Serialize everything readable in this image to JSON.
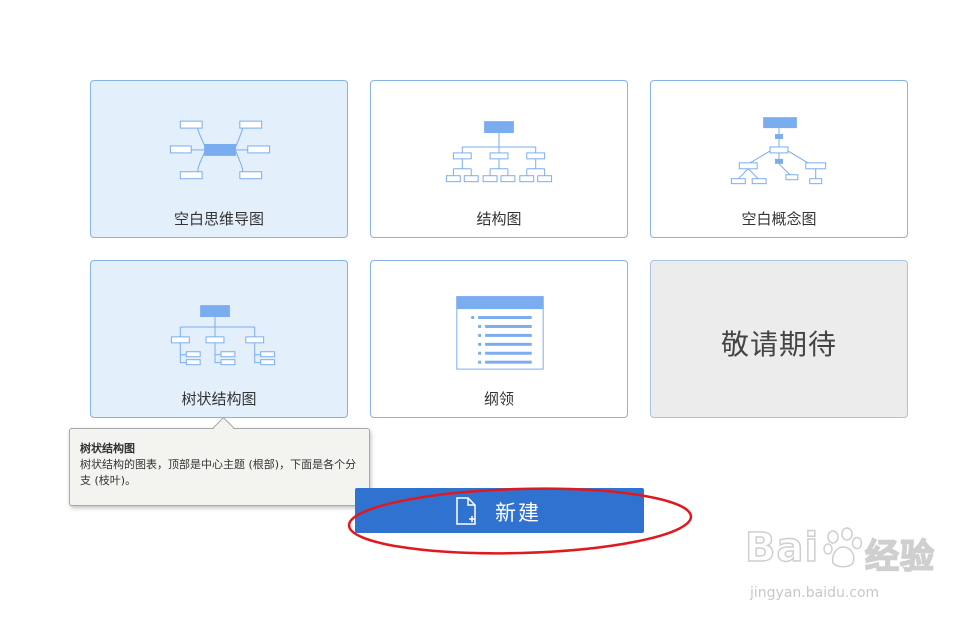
{
  "templates": [
    {
      "label": "空白思维导图",
      "icon": "mind-map-icon",
      "selected": true
    },
    {
      "label": "结构图",
      "icon": "org-chart-icon",
      "selected": false
    },
    {
      "label": "空白概念图",
      "icon": "concept-map-icon",
      "selected": false
    },
    {
      "label": "树状结构图",
      "icon": "tree-chart-icon",
      "selected": true
    },
    {
      "label": "纲领",
      "icon": "outline-icon",
      "selected": false
    },
    {
      "label": "敬请期待",
      "icon": "",
      "selected": false
    }
  ],
  "tooltip": {
    "title": "树状结构图",
    "body": "树状结构的图表，顶部是中心主题 (根部)，下面是各个分支 (枝叶)。"
  },
  "new_button": {
    "label": "新建",
    "icon": "new-file-icon"
  },
  "watermark": {
    "brand": "Bai",
    "brand_cn": "经验",
    "url": "jingyan.baidu.com"
  },
  "colors": {
    "accent": "#3072d0",
    "card_border": "#86b3e6",
    "card_selected_bg": "#e4effc",
    "icon_blue": "#7aacf0",
    "annotation_red": "#e0191e"
  }
}
